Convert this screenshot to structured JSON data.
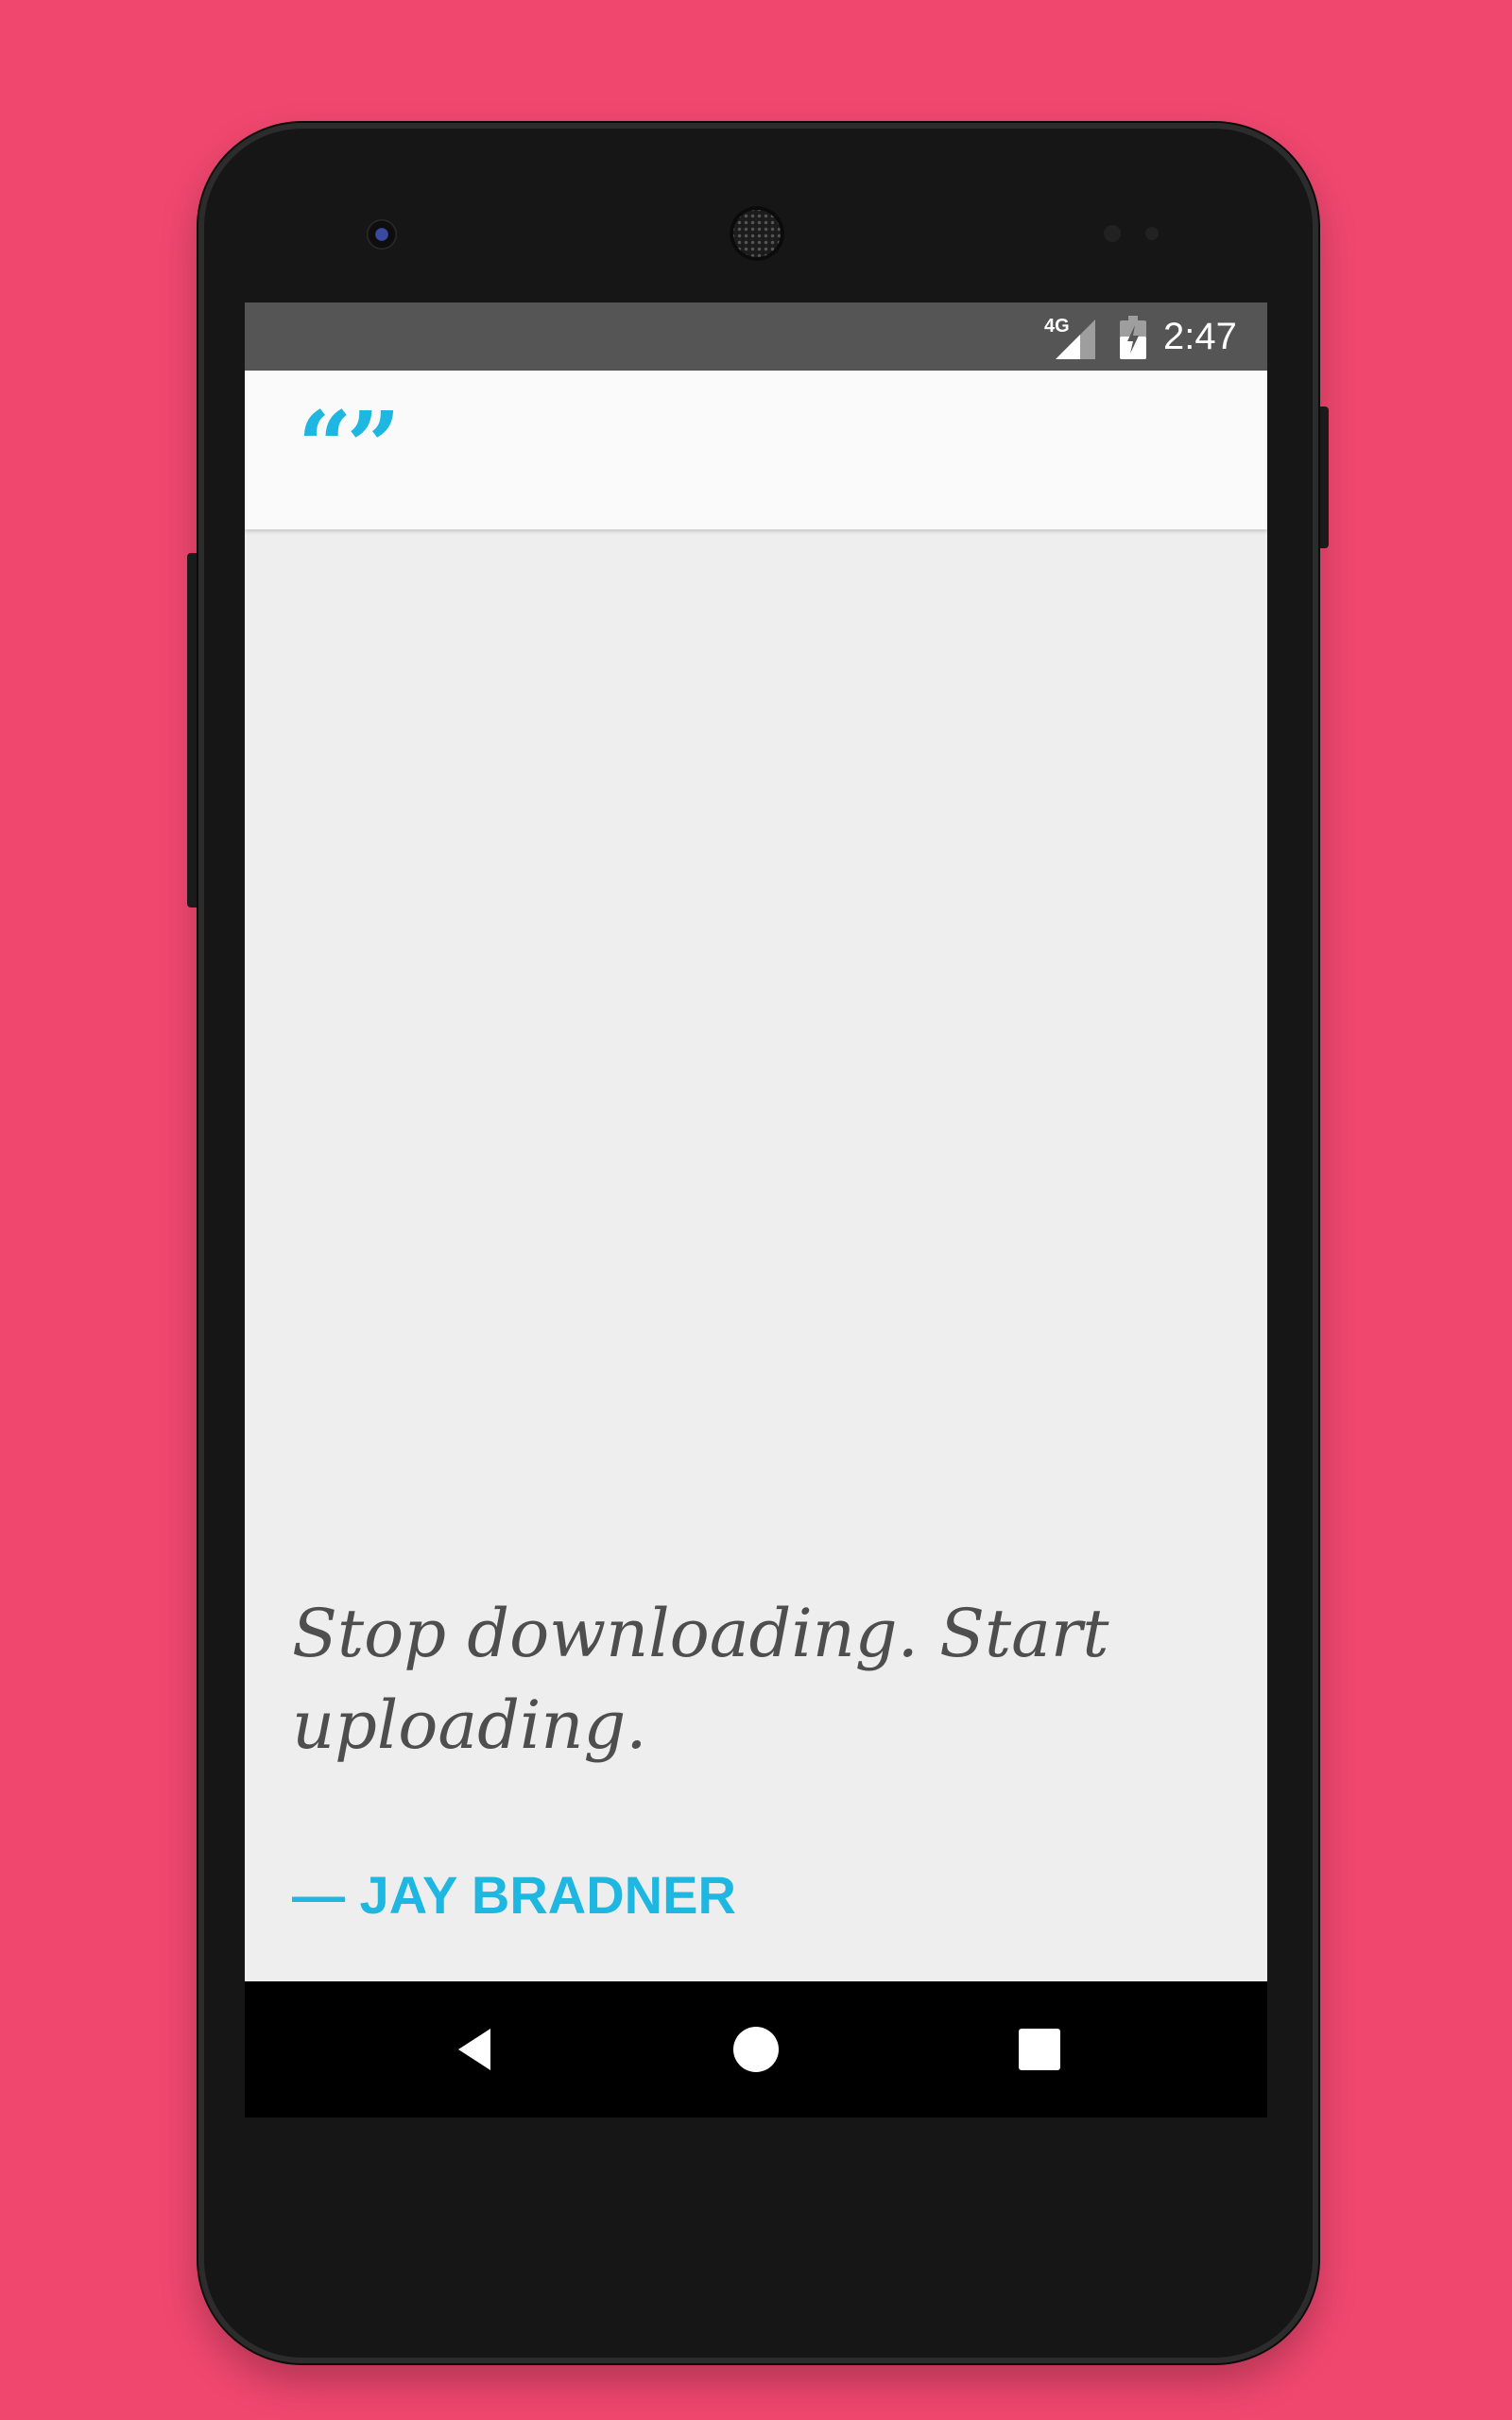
{
  "colors": {
    "background": "#F0476F",
    "accent": "#1EB7E2",
    "status_bar": "#555555",
    "app_bar": "#FAFAFA",
    "content": "#EEEEEE",
    "quote_text": "#4E4E4E",
    "nav_bar": "#000000"
  },
  "status_bar": {
    "network": "4G",
    "time": "2:47",
    "icons": [
      "signal-icon",
      "battery-charging-icon"
    ]
  },
  "app_bar": {
    "logo_text": "“”",
    "logo_icon": "quote-marks-icon"
  },
  "quote": {
    "text": "Stop downloading. Start uploading.",
    "author": "— JAY BRADNER"
  },
  "nav_bar": {
    "icons": [
      "back-icon",
      "home-icon",
      "recents-icon"
    ]
  }
}
